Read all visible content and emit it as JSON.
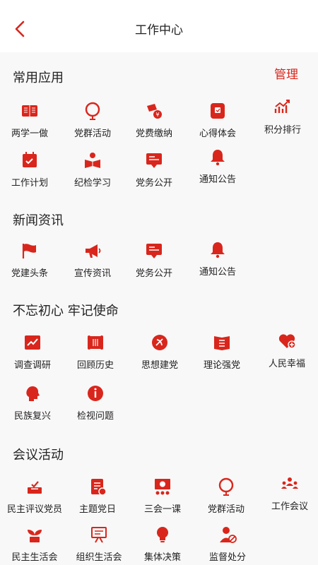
{
  "header": {
    "title": "工作中心"
  },
  "common": {
    "title": "常用应用",
    "manage": "管理",
    "items": [
      "两学一做",
      "党群活动",
      "党费缴纳",
      "心得体会",
      "积分排行",
      "工作计划",
      "纪检学习",
      "党务公开",
      "通知公告"
    ]
  },
  "news": {
    "title": "新闻资讯",
    "items": [
      "党建头条",
      "宣传资讯",
      "党务公开",
      "通知公告"
    ]
  },
  "mission": {
    "title": "不忘初心 牢记使命",
    "items": [
      "调查调研",
      "回顾历史",
      "思想建党",
      "理论强党",
      "人民幸福",
      "民族复兴",
      "检视问题"
    ]
  },
  "meeting": {
    "title": "会议活动",
    "items": [
      "民主评议党员",
      "主题党日",
      "三会一课",
      "党群活动",
      "工作会议",
      "民主生活会",
      "组织生活会",
      "集体决策",
      "监督处分"
    ]
  },
  "colors": {
    "accent": "#d9261c"
  }
}
